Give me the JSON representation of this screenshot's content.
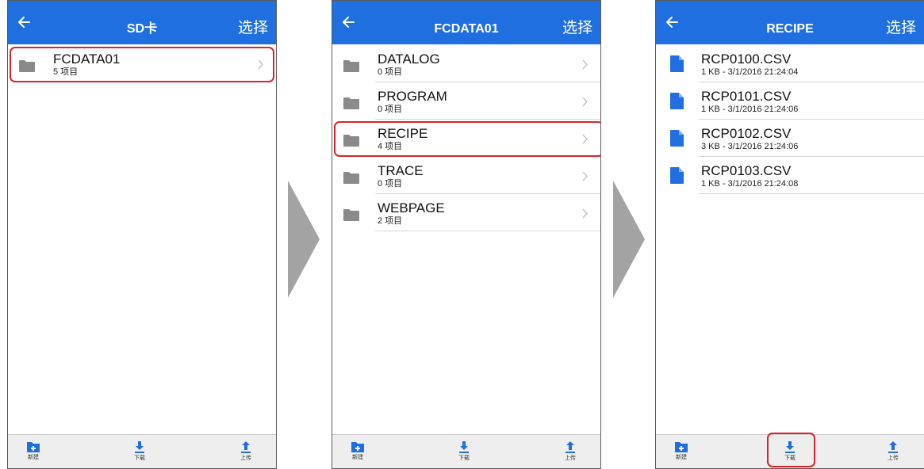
{
  "colors": {
    "header": "#1f6fe0",
    "highlight": "#d9232d",
    "file_icon": "#1f6fe0",
    "folder_icon": "#8a8a8a"
  },
  "screens": [
    {
      "title": "SD卡",
      "action": "选择",
      "items": [
        {
          "name": "FCDATA01",
          "meta": "5 项目",
          "icon": "folder-icon"
        }
      ],
      "toolbar": {
        "new": "新建",
        "download": "下载",
        "upload": "上传"
      }
    },
    {
      "title": "FCDATA01",
      "action": "选择",
      "items": [
        {
          "name": "DATALOG",
          "meta": "0 项目",
          "icon": "folder-icon"
        },
        {
          "name": "PROGRAM",
          "meta": "0 项目",
          "icon": "folder-icon"
        },
        {
          "name": "RECIPE",
          "meta": "4 项目",
          "icon": "folder-icon"
        },
        {
          "name": "TRACE",
          "meta": "0 项目",
          "icon": "folder-icon"
        },
        {
          "name": "WEBPAGE",
          "meta": "2 项目",
          "icon": "folder-icon"
        }
      ],
      "toolbar": {
        "new": "新建",
        "download": "下载",
        "upload": "上传"
      }
    },
    {
      "title": "RECIPE",
      "action": "选择",
      "items": [
        {
          "name": "RCP0100.CSV",
          "meta": "1 KB - 3/1/2016 21:24:04",
          "icon": "file-icon"
        },
        {
          "name": "RCP0101.CSV",
          "meta": "1 KB - 3/1/2016 21:24:06",
          "icon": "file-icon"
        },
        {
          "name": "RCP0102.CSV",
          "meta": "3 KB - 3/1/2016 21:24:06",
          "icon": "file-icon"
        },
        {
          "name": "RCP0103.CSV",
          "meta": "1 KB - 3/1/2016 21:24:08",
          "icon": "file-icon"
        }
      ],
      "toolbar": {
        "new": "新建",
        "download": "下载",
        "upload": "上传"
      }
    }
  ]
}
